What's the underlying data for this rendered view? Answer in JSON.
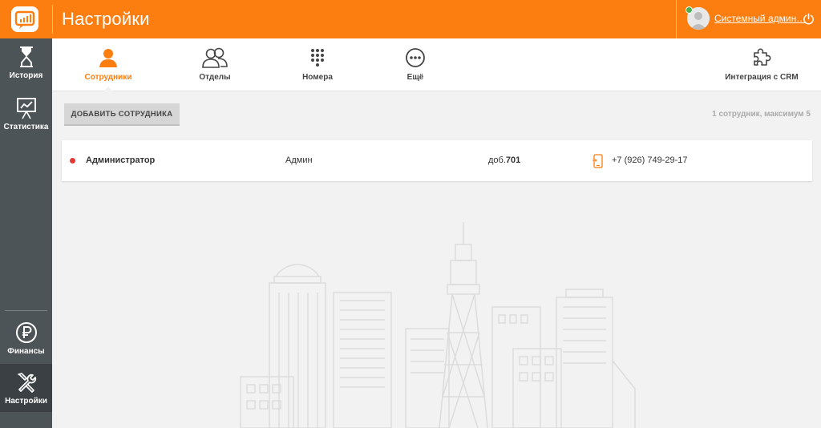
{
  "header": {
    "title": "Настройки",
    "user_name": "Системный админ…",
    "accent_color": "#fd7e10"
  },
  "sidebar": {
    "items": [
      {
        "label": "История",
        "icon": "hourglass-icon"
      },
      {
        "label": "Статистика",
        "icon": "chart-board-icon"
      },
      {
        "label": "Финансы",
        "icon": "ruble-coin-icon"
      },
      {
        "label": "Настройки",
        "icon": "wrench-screwdriver-icon",
        "active": true
      }
    ]
  },
  "tabs": [
    {
      "label": "Сотрудники",
      "icon": "person-icon",
      "active": true
    },
    {
      "label": "Отделы",
      "icon": "people-icon"
    },
    {
      "label": "Номера",
      "icon": "keypad-icon"
    },
    {
      "label": "Ещё",
      "icon": "more-icon"
    },
    {
      "label": "Интеграция с CRM",
      "icon": "puzzle-icon"
    }
  ],
  "toolbar": {
    "add_button_label": "ДОБАВИТЬ СОТРУДНИКА",
    "count_text": "1 сотрудник, максимум 5"
  },
  "employees": [
    {
      "name": "Администратор",
      "role": "Админ",
      "ext_prefix": "доб.",
      "ext_number": "701",
      "phone": "+7 (926) 749-29-17",
      "status_color": "#e53935"
    }
  ]
}
